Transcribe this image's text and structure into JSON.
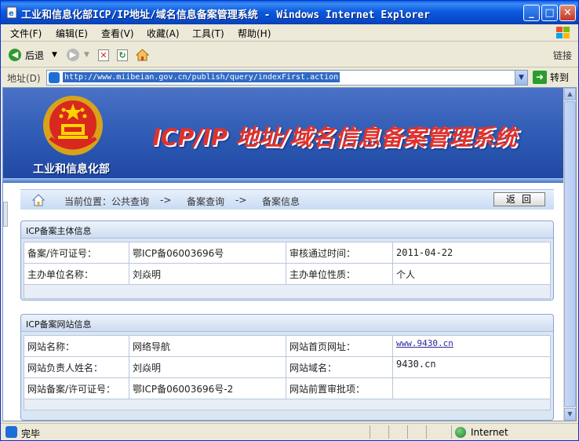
{
  "window": {
    "title": "工业和信息化部ICP/IP地址/域名信息备案管理系统 - Windows Internet Explorer",
    "buttons": {
      "minimize": "_",
      "maximize": "□",
      "close": "✕"
    }
  },
  "menu": [
    "文件(F)",
    "编辑(E)",
    "查看(V)",
    "收藏(A)",
    "工具(T)",
    "帮助(H)"
  ],
  "toolbar": {
    "back_label": "后退",
    "links_label": "链接"
  },
  "address": {
    "label": "地址(D)",
    "url": "http://www.miibeian.gov.cn/publish/query/indexFirst.action",
    "go_label": "转到"
  },
  "banner": {
    "ministry": "工业和信息化部",
    "title": "ICP/IP 地址/域名信息备案管理系统"
  },
  "breadcrumb": {
    "prefix": "当前位置：公共查询",
    "sep1": "->",
    "item2": "备案查询",
    "sep2": "->",
    "item3": "备案信息",
    "back_button": "返回"
  },
  "panel1": {
    "header": "ICP备案主体信息",
    "rows": [
      [
        "备案/许可证号：",
        "鄂ICP备06003696号",
        "审核通过时间：",
        "2011-04-22"
      ],
      [
        "主办单位名称：",
        "刘焱明",
        "主办单位性质：",
        "个人"
      ]
    ]
  },
  "panel2": {
    "header": "ICP备案网站信息",
    "rows": [
      [
        "网站名称：",
        "网络导航",
        "网站首页网址：",
        "www.9430.cn"
      ],
      [
        "网站负责人姓名：",
        "刘焱明",
        "网站域名：",
        "9430.cn"
      ],
      [
        "网站备案/许可证号：",
        "鄂ICP备06003696号-2",
        "网站前置审批项：",
        ""
      ]
    ]
  },
  "status": {
    "text": "完毕",
    "zone": "Internet"
  }
}
